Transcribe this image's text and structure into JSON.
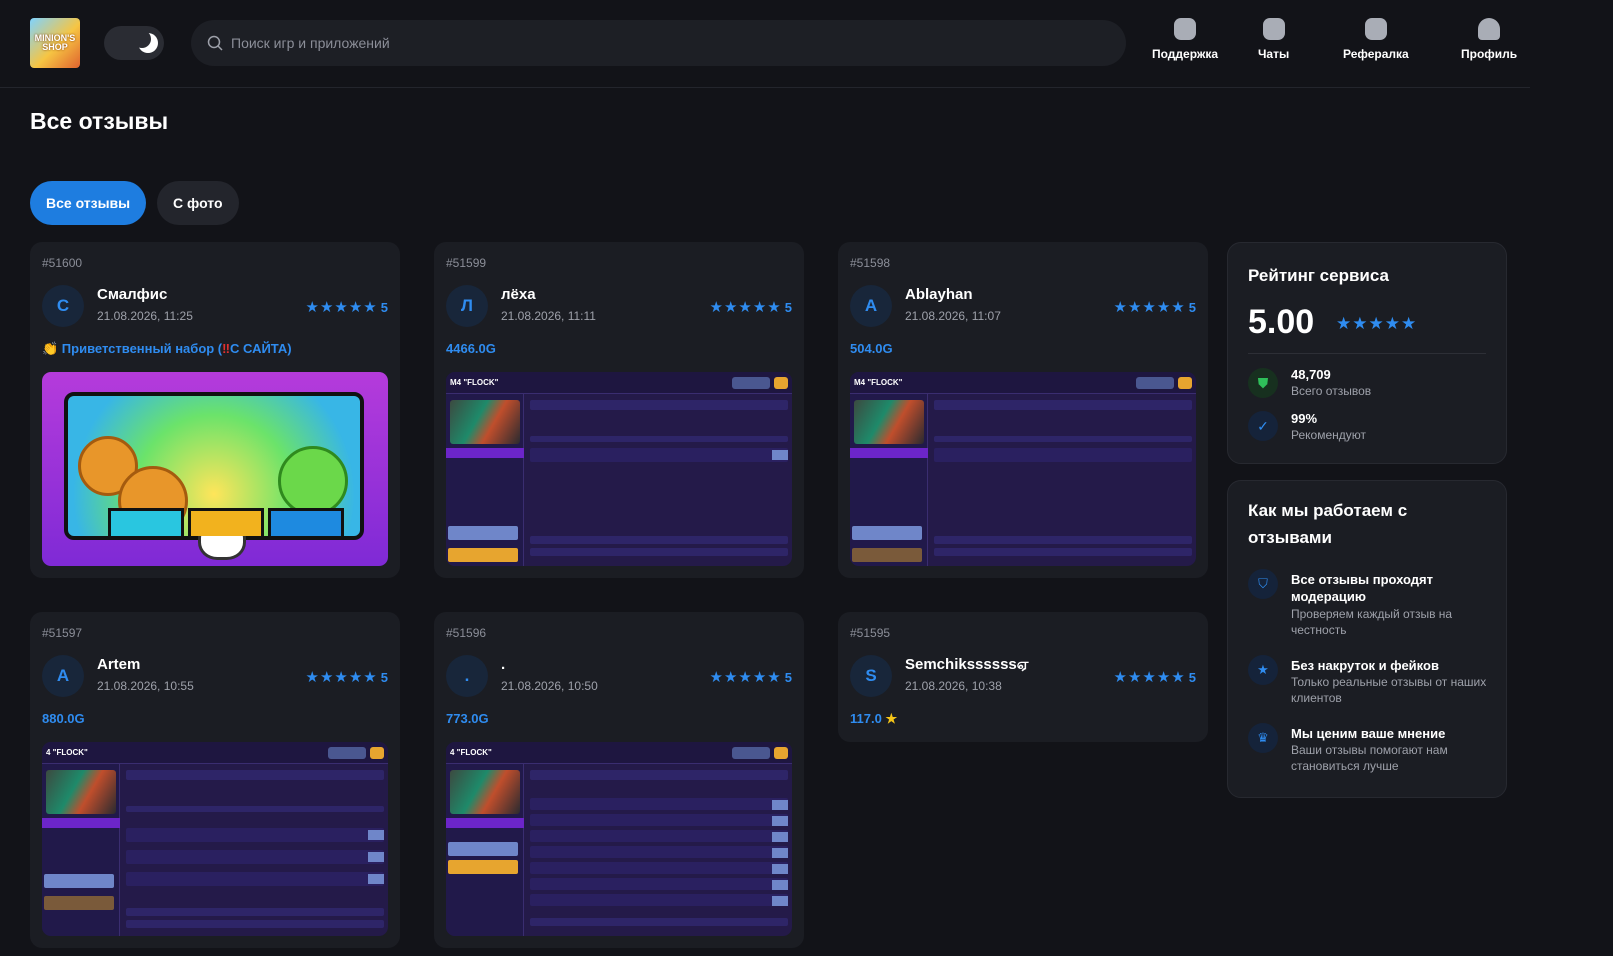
{
  "header": {
    "logo_text": "MINION'S SHOP",
    "search_placeholder": "Поиск игр и приложений",
    "nav": [
      "Поддержка",
      "Чаты",
      "Рефералка",
      "Профиль"
    ]
  },
  "page_title": "Все отзывы",
  "tabs": [
    "Все отзывы",
    "С фото"
  ],
  "reviews": [
    {
      "id": "#51600",
      "initial": "С",
      "name": "Смалфис",
      "date": "21.08.2026, 11:25",
      "rating": "5",
      "text_prefix": "👏 Приветственный набор (",
      "text_mark": "‼",
      "text_suffix": "С САЙТА)",
      "shot": "game"
    },
    {
      "id": "#51599",
      "initial": "Л",
      "name": "лёха",
      "date": "21.08.2026, 11:11",
      "rating": "5",
      "text": "4466.0G",
      "shot": "market",
      "shot_title": "M4 \"FLOCK\""
    },
    {
      "id": "#51598",
      "initial": "A",
      "name": "Ablayhan",
      "date": "21.08.2026, 11:07",
      "rating": "5",
      "text": "504.0G",
      "shot": "market",
      "shot_title": "M4 \"FLOCK\""
    },
    {
      "id": "#51597",
      "initial": "A",
      "name": "Artem",
      "date": "21.08.2026, 10:55",
      "rating": "5",
      "text": "880.0G",
      "shot": "market",
      "shot_title": "4 \"FLOCK\""
    },
    {
      "id": "#51596",
      "initial": ".",
      "name": ".",
      "date": "21.08.2026, 10:50",
      "rating": "5",
      "text": "773.0G",
      "shot": "market",
      "shot_title": "4 \"FLOCK\""
    },
    {
      "id": "#51595",
      "initial": "S",
      "name": "Semchikssssssஏ",
      "date": "21.08.2026, 10:38",
      "rating": "5",
      "text": "117.0",
      "text_star": "★"
    }
  ],
  "sidebar": {
    "rating_title": "Рейтинг сервиса",
    "rating_value": "5.00",
    "total_reviews": "48,709",
    "total_reviews_label": "Всего отзывов",
    "recommend": "99%",
    "recommend_label": "Рекомендуют",
    "how_title": "Как мы работаем с отзывами",
    "how_items": [
      {
        "title": "Все отзывы проходят модерацию",
        "desc": "Проверяем каждый отзыв на честность"
      },
      {
        "title": "Без накруток и фейков",
        "desc": "Только реальные отзывы от наших клиентов"
      },
      {
        "title": "Мы ценим ваше мнение",
        "desc": "Ваши отзывы помогают нам становиться лучше"
      }
    ]
  },
  "colors": {
    "accent": "#2f8cf0",
    "background": "#121318",
    "card": "#1b1d23",
    "gold": "#f5c518"
  }
}
